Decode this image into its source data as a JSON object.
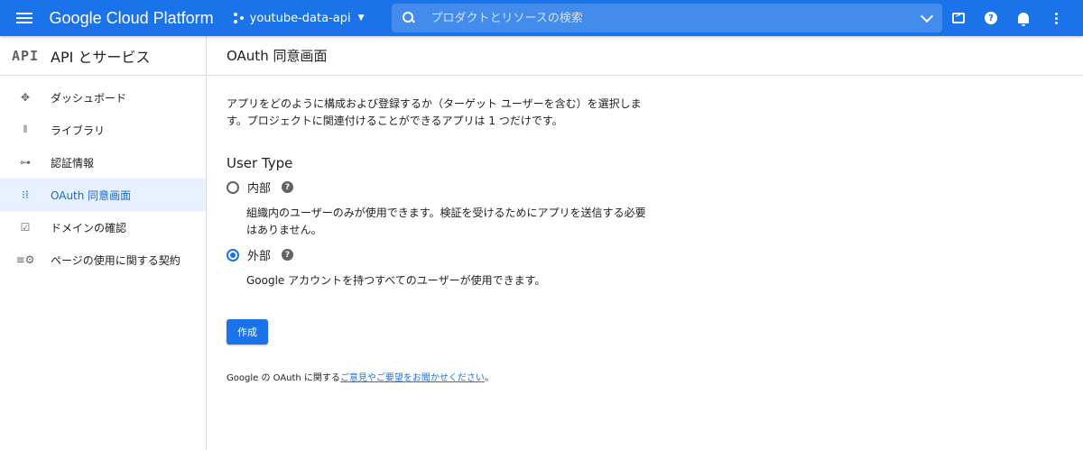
{
  "topbar": {
    "brand": "Google Cloud Platform",
    "project": "youtube-data-api",
    "search_placeholder": "プロダクトとリソースの検索",
    "accent": "#1a73e8"
  },
  "sidebar": {
    "logo": "API",
    "title": "API とサービス",
    "items": [
      {
        "label": "ダッシュボード",
        "icon": "dashboard-icon"
      },
      {
        "label": "ライブラリ",
        "icon": "library-icon"
      },
      {
        "label": "認証情報",
        "icon": "key-icon"
      },
      {
        "label": "OAuth 同意画面",
        "icon": "consent-icon",
        "active": true
      },
      {
        "label": "ドメインの確認",
        "icon": "checkbox-icon"
      },
      {
        "label": "ページの使用に関する契約",
        "icon": "settings-list-icon"
      }
    ]
  },
  "main": {
    "title": "OAuth 同意画面",
    "description": "アプリをどのように構成および登録するか（ターゲット ユーザーを含む）を選択します。プロジェクトに関連付けることができるアプリは 1 つだけです。",
    "user_type_title": "User Type",
    "options": [
      {
        "label": "内部",
        "checked": false,
        "description": "組織内のユーザーのみが使用できます。検証を受けるためにアプリを送信する必要はありません。"
      },
      {
        "label": "外部",
        "checked": true,
        "description": "Google アカウントを持つすべてのユーザーが使用できます。"
      }
    ],
    "create_label": "作成",
    "feedback_prefix": "Google の OAuth に関する",
    "feedback_link": "ご意見やご要望をお聞かせください",
    "feedback_suffix": "。"
  }
}
